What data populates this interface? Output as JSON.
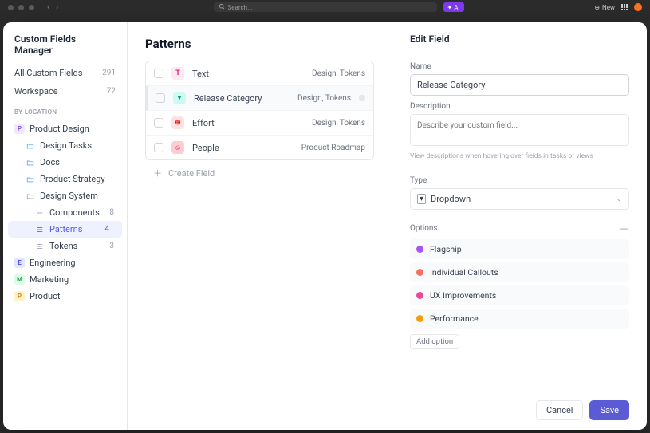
{
  "topbar": {
    "search_placeholder": "Search...",
    "ai_label": "AI",
    "new_label": "New"
  },
  "sidebar": {
    "title": "Custom Fields Manager",
    "rows": [
      {
        "label": "All Custom Fields",
        "count": "291"
      },
      {
        "label": "Workspace",
        "count": "72"
      }
    ],
    "heading": "BY LOCATION",
    "tree": {
      "product_design": {
        "label": "Product Design"
      },
      "design_tasks": {
        "label": "Design Tasks"
      },
      "docs": {
        "label": "Docs"
      },
      "product_strategy": {
        "label": "Product Strategy"
      },
      "design_system": {
        "label": "Design System"
      },
      "components": {
        "label": "Components",
        "count": "8"
      },
      "patterns": {
        "label": "Patterns",
        "count": "4"
      },
      "tokens": {
        "label": "Tokens",
        "count": "3"
      },
      "engineering": {
        "label": "Engineering"
      },
      "marketing": {
        "label": "Marketing"
      },
      "product": {
        "label": "Product"
      }
    }
  },
  "content": {
    "title": "Patterns",
    "fields": [
      {
        "icon": "T",
        "icon_class": "ft-text",
        "name": "Text",
        "location": "Design, Tokens"
      },
      {
        "icon": "▾",
        "icon_class": "ft-drop",
        "name": "Release Category",
        "location": "Design, Tokens",
        "selected": true
      },
      {
        "icon": "⊕",
        "icon_class": "ft-effort",
        "name": "Effort",
        "location": "Design, Tokens"
      },
      {
        "icon": "☺",
        "icon_class": "ft-people",
        "name": "People",
        "location": "Product Roadmap"
      }
    ],
    "create_label": "Create Field"
  },
  "panel": {
    "title": "Edit Field",
    "name_label": "Name",
    "name_value": "Release Category",
    "desc_label": "Description",
    "desc_placeholder": "Describe your custom field...",
    "desc_hint": "View descriptions when hovering over fields in tasks or views",
    "type_label": "Type",
    "type_value": "Dropdown",
    "options_label": "Options",
    "options": [
      {
        "label": "Flagship",
        "color": "#a855f7"
      },
      {
        "label": "Individual Callouts",
        "color": "#f77062"
      },
      {
        "label": "UX Improvements",
        "color": "#ec4899"
      },
      {
        "label": "Performance",
        "color": "#f59e0b"
      }
    ],
    "add_option_label": "Add option",
    "cancel_label": "Cancel",
    "save_label": "Save"
  }
}
